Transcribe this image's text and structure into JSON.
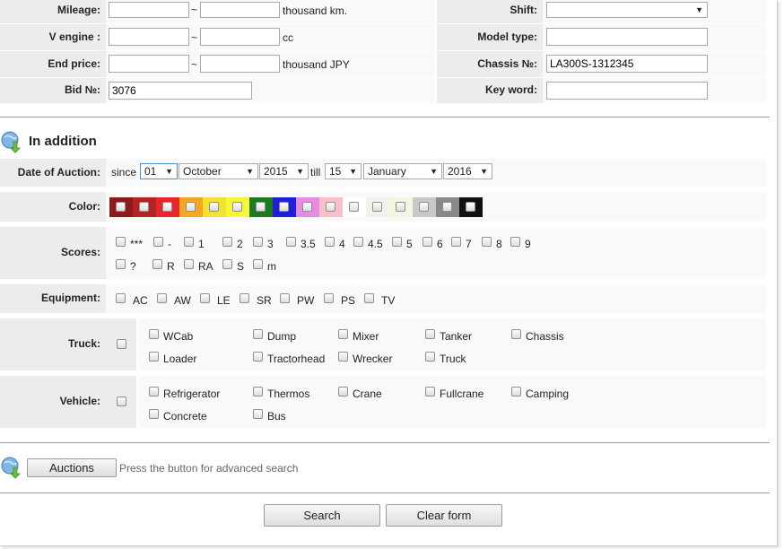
{
  "top_fields": {
    "mileage_label": "Mileage:",
    "mileage_unit": "thousand km.",
    "vengine_label": "V engine :",
    "vengine_unit": "cc",
    "end_price_label": "End price:",
    "end_price_unit": "thousand JPY",
    "bid_label": "Bid №:",
    "bid_value": "3076",
    "range_sep": "~",
    "shift_label": "Shift:",
    "model_type_label": "Model type:",
    "chassis_label": "Chassis №:",
    "chassis_value": "LA300S-1312345",
    "keyword_label": "Key word:"
  },
  "addition": {
    "title": "In addition",
    "date_label": "Date of Auction:",
    "since_label": "since",
    "since_day": "01",
    "since_month": "October",
    "since_year": "2015",
    "till_label": "till",
    "till_day": "15",
    "till_month": "January",
    "till_year": "2016",
    "color_label": "Color:",
    "colors": [
      "#8b1a1a",
      "#b22424",
      "#e8262a",
      "#f5a623",
      "#f3e234",
      "#f7f73a",
      "#1e7a1e",
      "#1f1fd8",
      "#e58ae5",
      "#f8c0c8",
      "#ffffff",
      "#f2f2ea",
      "#f4f6e2",
      "#c8c8c8",
      "#888888",
      "#111111"
    ],
    "scores_label": "Scores:",
    "scores_row1": [
      "***",
      "-",
      "1",
      "2",
      "3",
      "3.5",
      "4",
      "4.5",
      "5",
      "6",
      "7",
      "8",
      "9"
    ],
    "scores_row2": [
      "?",
      "R",
      "RA",
      "S",
      "m"
    ],
    "equipment_label": "Equipment:",
    "equipment": [
      "AC",
      "AW",
      "LE",
      "SR",
      "PW",
      "PS",
      "TV"
    ],
    "truck_label": "Truck:",
    "truck_row1": [
      "WCab",
      "Dump",
      "Mixer",
      "Tanker",
      "Chassis"
    ],
    "truck_row2": [
      "Loader",
      "Tractorhead",
      "Wrecker",
      "Truck"
    ],
    "vehicle_label": "Vehicle:",
    "vehicle_row1": [
      "Refrigerator",
      "Thermos",
      "Crane",
      "Fullcrane",
      "Camping"
    ],
    "vehicle_row2": [
      "Concrete",
      "Bus"
    ]
  },
  "auctions": {
    "button_label": "Auctions",
    "hint": "Press the button for advanced search"
  },
  "actions": {
    "search_label": "Search",
    "clear_label": "Clear form"
  },
  "icons": {
    "addition_icon": "globe-download-icon",
    "auctions_icon": "globe-download-icon",
    "dropdown_arrow": "chevron-down-icon"
  }
}
